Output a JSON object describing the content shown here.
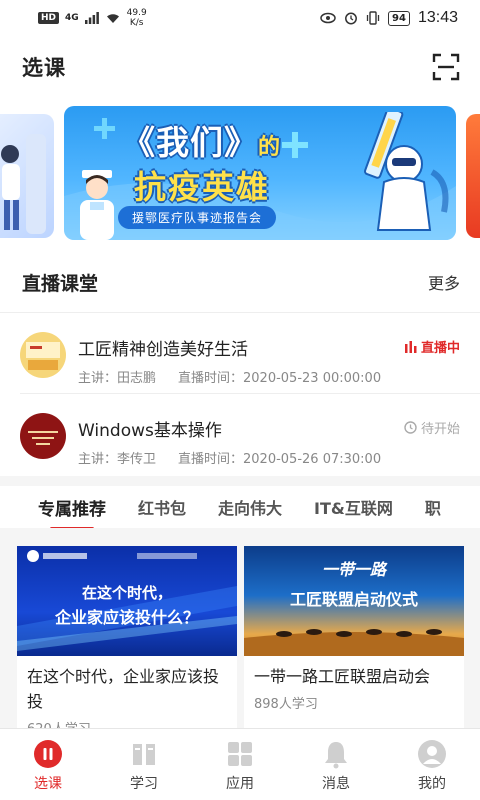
{
  "status_bar": {
    "hd": "HD",
    "network": "4G",
    "speed_value": "49.9",
    "speed_unit": "K/s",
    "battery": "94",
    "time": "13:43"
  },
  "header": {
    "title": "选课",
    "scan_icon": "scan-icon"
  },
  "banner": {
    "title_line1": "《我们》",
    "title_de": "的",
    "title_line2": "抗疫英雄",
    "subtitle": "援鄂医疗队事迹报告会"
  },
  "live_section": {
    "title": "直播课堂",
    "more": "更多",
    "items": [
      {
        "name": "工匠精神创造美好生活",
        "lecturer": "主讲：田志鹏",
        "time": "直播时间：2020-05-23 00:00:00",
        "status": "直播中"
      },
      {
        "name": "Windows基本操作",
        "lecturer": "主讲：李传卫",
        "time": "直播时间：2020-05-26 07:30:00",
        "status": "待开始"
      }
    ]
  },
  "tabs": [
    "专属推荐",
    "红书包",
    "走向伟大",
    "IT&互联网",
    "职"
  ],
  "cards": [
    {
      "image_caption_line1": "在这个时代，",
      "image_caption_line2": "企业家应该投什么？",
      "title": "在这个时代，企业家应该投",
      "count": "620人学习"
    },
    {
      "image_caption_line1": "一带一路",
      "image_caption_line2": "工匠联盟启动仪式",
      "title": "一带一路工匠联盟启动会",
      "count": "898人学习"
    }
  ],
  "bottom_nav": [
    {
      "label": "选课",
      "icon": "play-icon",
      "active": true
    },
    {
      "label": "学习",
      "icon": "book-icon",
      "active": false
    },
    {
      "label": "应用",
      "icon": "grid-icon",
      "active": false
    },
    {
      "label": "消息",
      "icon": "bell-icon",
      "active": false
    },
    {
      "label": "我的",
      "icon": "user-icon",
      "active": false
    }
  ],
  "colors": {
    "accent": "#e02a2a",
    "muted": "#888888",
    "banner_blue": "#2b9bf2"
  }
}
